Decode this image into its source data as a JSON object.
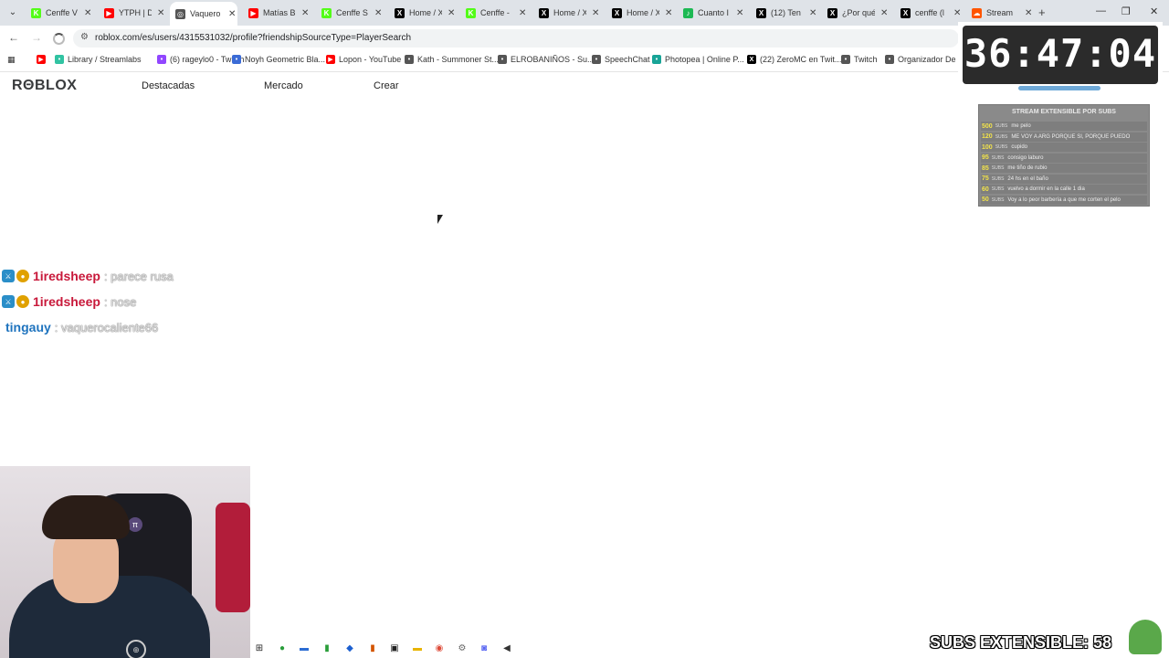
{
  "tabs": [
    {
      "label": "Cenffe V",
      "icon": "kick-icon",
      "color": "#53fc18"
    },
    {
      "label": "YTPH | D",
      "icon": "youtube-icon",
      "color": "#ff0000"
    },
    {
      "label": "Vaquero",
      "icon": "roblox-icon",
      "color": "#555555",
      "active": true
    },
    {
      "label": "Matías B",
      "icon": "youtube-icon",
      "color": "#ff0000"
    },
    {
      "label": "Cenffe S",
      "icon": "kick-icon",
      "color": "#53fc18"
    },
    {
      "label": "Home / X",
      "icon": "x-icon",
      "color": "#000000"
    },
    {
      "label": "Cenffe -",
      "icon": "kick-icon",
      "color": "#53fc18"
    },
    {
      "label": "Home / X",
      "icon": "x-icon",
      "color": "#000000"
    },
    {
      "label": "Home / X",
      "icon": "x-icon",
      "color": "#000000"
    },
    {
      "label": "Cuanto I",
      "icon": "spotify-icon",
      "color": "#1db954"
    },
    {
      "label": "(12) Ten",
      "icon": "x-icon",
      "color": "#000000"
    },
    {
      "label": "¿Por qué",
      "icon": "x-icon",
      "color": "#000000"
    },
    {
      "label": "cenffe (l",
      "icon": "x-icon",
      "color": "#000000"
    },
    {
      "label": "Stream",
      "icon": "soundcloud-icon",
      "color": "#ff5500"
    }
  ],
  "address": {
    "url": "roblox.com/es/users/4315531032/profile?friendshipSourceType=PlayerSearch"
  },
  "bookmarks": [
    {
      "label": "",
      "icon": "youtube-icon",
      "color": "#ff0000"
    },
    {
      "label": "Library / Streamlabs",
      "icon": "streamlabs-icon",
      "color": "#31c3a2"
    },
    {
      "label": "(6) rageylo0 - Twitch",
      "icon": "twitch-icon",
      "color": "#9146ff"
    },
    {
      "label": "Noyh Geometric Bla...",
      "icon": "bookmark-icon",
      "color": "#3b6bd6"
    },
    {
      "label": "Lopon - YouTube",
      "icon": "youtube-icon",
      "color": "#ff0000"
    },
    {
      "label": "Kath - Summoner St...",
      "icon": "globe-icon",
      "color": "#555555"
    },
    {
      "label": "ELROBANIÑOS - Su...",
      "icon": "globe-icon",
      "color": "#555555"
    },
    {
      "label": "SpeechChat",
      "icon": "globe-icon",
      "color": "#555555"
    },
    {
      "label": "Photopea | Online P...",
      "icon": "photopea-icon",
      "color": "#18a497"
    },
    {
      "label": "(22) ZeroMC en Twit...",
      "icon": "x-icon",
      "color": "#000000"
    },
    {
      "label": "Twitch",
      "icon": "globe-icon",
      "color": "#555555"
    },
    {
      "label": "Organizador De Z...",
      "icon": "globe-icon",
      "color": "#555555"
    }
  ],
  "roblox": {
    "logo": "RΘBLOX",
    "nav": [
      "Destacadas",
      "Mercado",
      "Crear"
    ]
  },
  "timer": {
    "value": "36:47:04"
  },
  "panel": {
    "title": "STREAM EXTENSIBLE POR SUBS",
    "subs_label": "SUBS",
    "rows": [
      {
        "n": "500",
        "text": "me pelo"
      },
      {
        "n": "120",
        "text": "ME VOY A ARG PORQUE SI, PORQUE PUEDO"
      },
      {
        "n": "100",
        "text": "cupido"
      },
      {
        "n": "95",
        "text": "consigo laburo"
      },
      {
        "n": "85",
        "text": "me tiño de rubio"
      },
      {
        "n": "75",
        "text": "24 hs en el baño"
      },
      {
        "n": "60",
        "text": "vuelvo a dormir en la calle 1 dia"
      },
      {
        "n": "50",
        "text": "Voy a lo peor barbería a que me corten el pelo"
      }
    ]
  },
  "chat": [
    {
      "user": "1iredsheep",
      "color": "#c8183a",
      "msg": ": parece rusa",
      "badges": [
        "mod",
        "vip"
      ]
    },
    {
      "user": "1iredsheep",
      "color": "#c8183a",
      "msg": ": nose",
      "badges": [
        "mod",
        "vip"
      ]
    },
    {
      "user": "tingauy",
      "color": "#1e73be",
      "msg": ": vaquerocaliente66",
      "badges": []
    }
  ],
  "overlay": {
    "subs_text": "SUBS EXTENSIBLE: 58"
  }
}
